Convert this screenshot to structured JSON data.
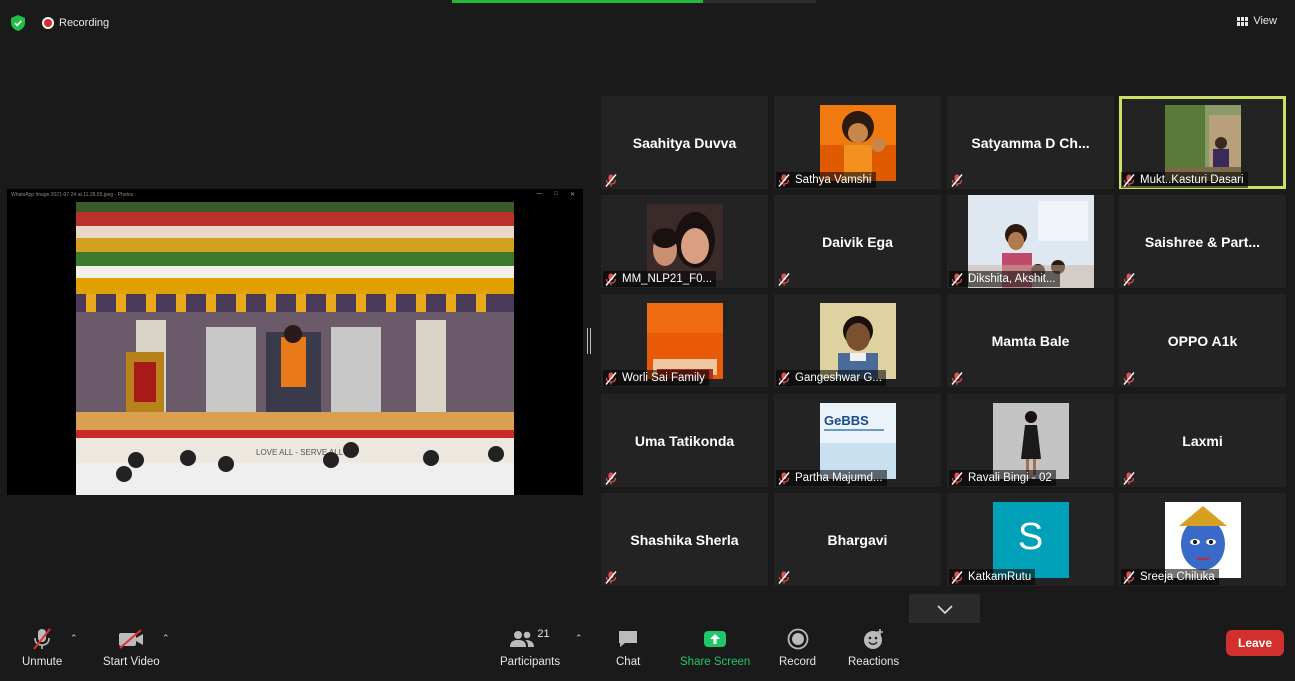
{
  "app": {
    "recording_label": "Recording",
    "view_label": "View",
    "share_window_title": "WhatsApp Image 2021-07-24 at 11.28.55.jpeg - Photos",
    "photo_banner_text": "LOVE ALL - SERVE ALL",
    "share_progress": 0.69
  },
  "colors": {
    "active_speaker_border": "#c9e265",
    "recording_red": "#e02828",
    "share_green": "#1ec76a",
    "leave_red": "#d2302c",
    "tile_bg": "#232323",
    "muted_red": "#e05050"
  },
  "participants": [
    {
      "name": "Saahitya Duvva",
      "label": "",
      "has_video": false
    },
    {
      "name": "Sathya Vamshi",
      "label": "Sathya Vamshi",
      "has_video": true,
      "pic": "orange-portrait"
    },
    {
      "name": "Satyamma D Ch...",
      "label": "",
      "has_video": false
    },
    {
      "name": "Mukt..Kasturi Dasari",
      "label": "Mukt..Kasturi Dasari",
      "has_video": true,
      "pic": "garden-portrait",
      "active": true
    },
    {
      "name": "MM_NLP21_F0...",
      "label": "MM_NLP21_F0...",
      "has_video": true,
      "pic": "two-faces"
    },
    {
      "name": "Daivik Ega",
      "label": "",
      "has_video": false
    },
    {
      "name": "Dikshita, Akshit...",
      "label": "Dikshita, Akshit...",
      "has_video": true,
      "pic": "kids-room"
    },
    {
      "name": "Saishree & Part...",
      "label": "",
      "has_video": false
    },
    {
      "name": "Worli Sai Family",
      "label": "Worli Sai Family",
      "has_video": true,
      "pic": "orange-robe"
    },
    {
      "name": "Gangeshwar G...",
      "label": "Gangeshwar G...",
      "has_video": true,
      "pic": "smiling-man"
    },
    {
      "name": "Mamta Bale",
      "label": "",
      "has_video": false
    },
    {
      "name": "OPPO A1k",
      "label": "",
      "has_video": false
    },
    {
      "name": "Uma Tatikonda",
      "label": "",
      "has_video": false
    },
    {
      "name": "Partha Majumd...",
      "label": "Partha Majumd...",
      "has_video": true,
      "pic": "gebbs-logo",
      "logo_text": "GeBBS"
    },
    {
      "name": "Ravali Bingi - 02",
      "label": "Ravali Bingi - 02",
      "has_video": true,
      "pic": "standing-woman"
    },
    {
      "name": "Laxmi",
      "label": "",
      "has_video": false
    },
    {
      "name": "Shashika Sherla",
      "label": "",
      "has_video": false
    },
    {
      "name": "Bhargavi",
      "label": "",
      "has_video": false
    },
    {
      "name": "KatkamRutu",
      "label": "KatkamRutu",
      "has_video": true,
      "pic": "initial-s",
      "initial": "S"
    },
    {
      "name": "Sreeja Chiluka",
      "label": "Sreeja Chiluka",
      "has_video": true,
      "pic": "krishna-art"
    }
  ],
  "toolbar": {
    "unmute": "Unmute",
    "start_video": "Start Video",
    "participants": "Participants",
    "participants_count": "21",
    "chat": "Chat",
    "share_screen": "Share Screen",
    "record": "Record",
    "reactions": "Reactions",
    "leave": "Leave"
  }
}
